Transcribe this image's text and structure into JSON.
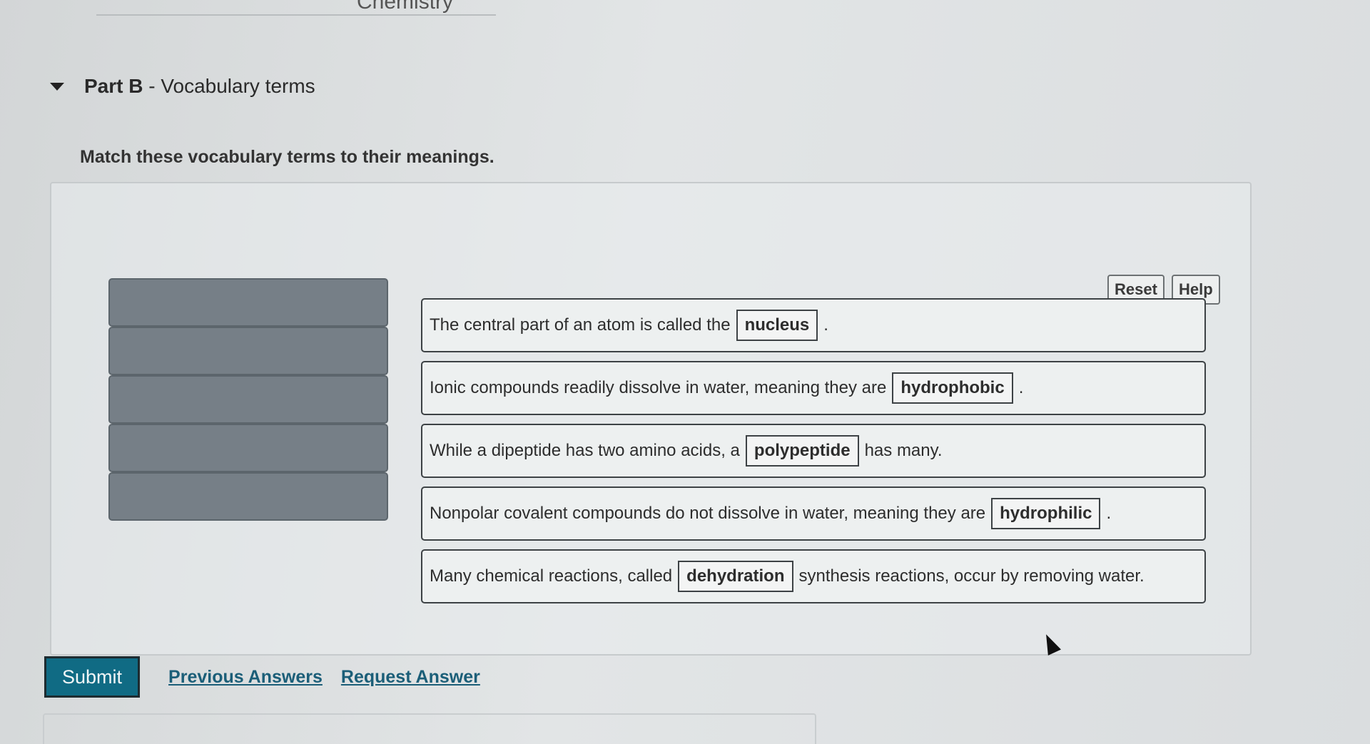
{
  "top_heading": "Chemistry",
  "part": {
    "label": "Part B",
    "separator": " - ",
    "title": "Vocabulary terms"
  },
  "instructions": "Match these vocabulary terms to their meanings.",
  "toolbar": {
    "reset_label": "Reset",
    "help_label": "Help"
  },
  "sentences": [
    {
      "before": "The central part of an atom is called the",
      "term": "nucleus",
      "after": "."
    },
    {
      "before": "Ionic compounds readily dissolve in water, meaning they are",
      "term": "hydrophobic",
      "after": "."
    },
    {
      "before": "While a dipeptide has two amino acids, a",
      "term": "polypeptide",
      "after": "has many."
    },
    {
      "before": "Nonpolar covalent compounds do not dissolve in water, meaning they are",
      "term": "hydrophilic",
      "after": "."
    },
    {
      "before": "Many chemical reactions, called",
      "term": "dehydration",
      "after": "synthesis reactions, occur by removing water."
    }
  ],
  "actions": {
    "submit_label": "Submit",
    "previous_answers_label": "Previous Answers",
    "request_answer_label": "Request Answer"
  },
  "colors": {
    "submit_bg": "#106b84",
    "empty_slot": "#767f87",
    "link": "#1b5e78"
  }
}
